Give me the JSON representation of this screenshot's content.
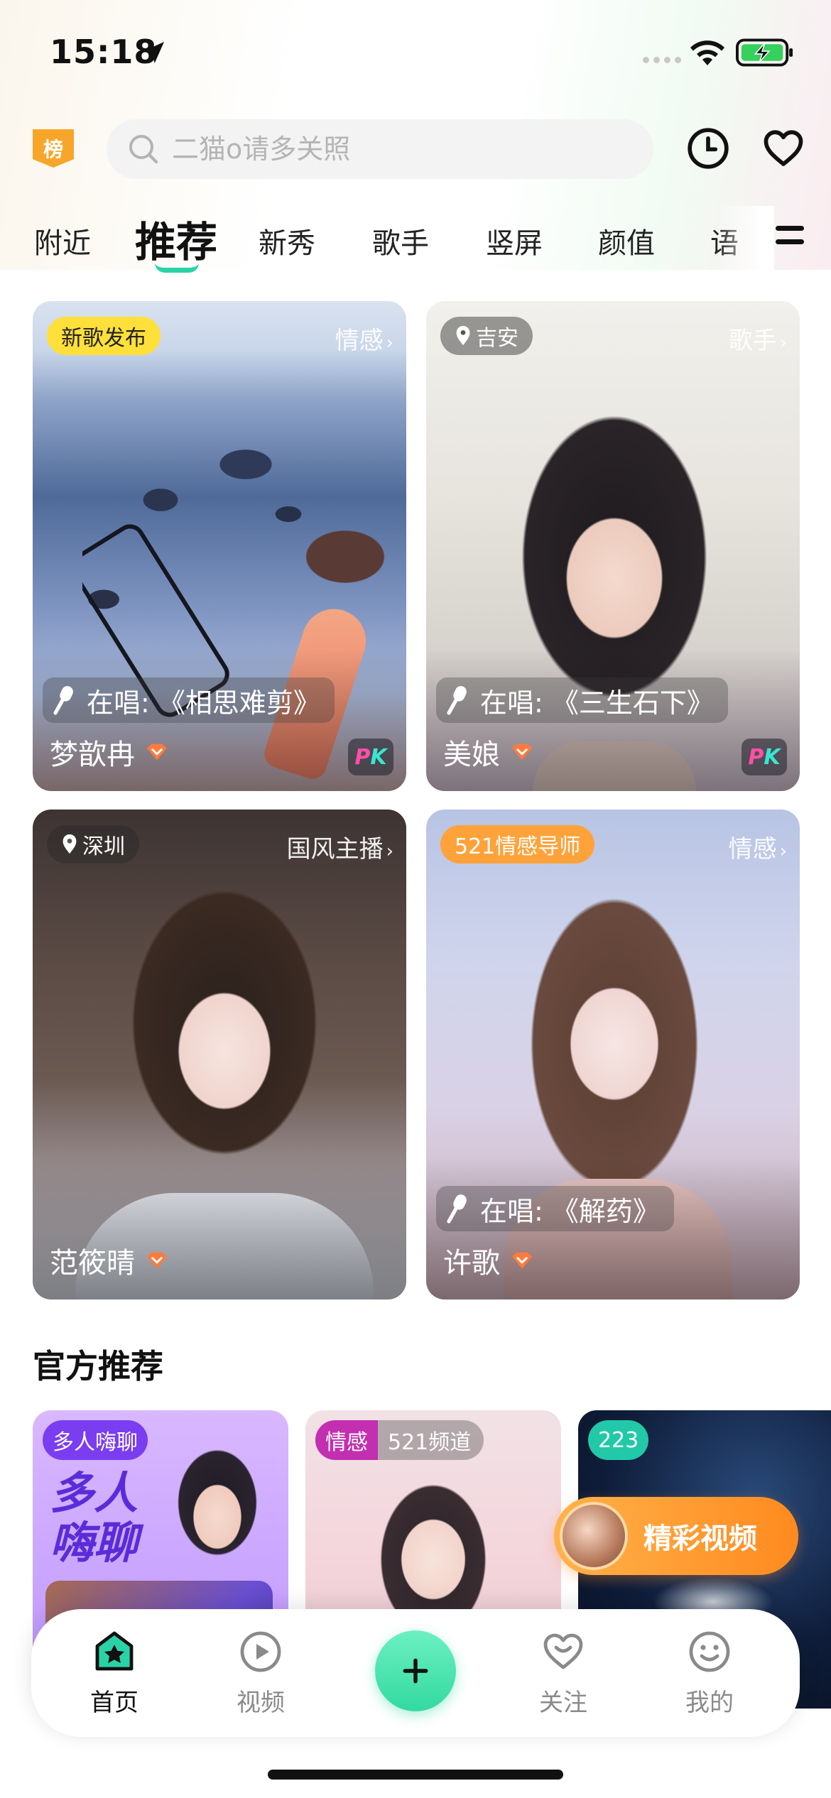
{
  "status_bar": {
    "time": "15:18"
  },
  "header": {
    "rank_badge": "榜",
    "search_placeholder": "二猫o请多关照"
  },
  "tabs": [
    "附近",
    "推荐",
    "新秀",
    "歌手",
    "竖屏",
    "颜值",
    "语"
  ],
  "active_tab": "推荐",
  "live_cards": [
    {
      "tag": "新歌发布",
      "category": "情感",
      "singing": "在唱: 《相思难剪》",
      "name": "梦歆冉",
      "pk": "PK"
    },
    {
      "location": "吉安",
      "category": "歌手",
      "singing": "在唱: 《三生石下》",
      "name": "美娘",
      "pk": "PK"
    },
    {
      "location": "深圳",
      "category": "国风主播",
      "name": "范筱晴"
    },
    {
      "tag": "521情感导师",
      "category": "情感",
      "singing": "在唱: 《解药》",
      "name": "许歌"
    }
  ],
  "section": {
    "title": "官方推荐"
  },
  "rec_cards": [
    {
      "tag": "多人嗨聊",
      "promo_text": "多人\n嗨聊"
    },
    {
      "tag": "情感",
      "channel": "521频道"
    },
    {
      "count": "223"
    }
  ],
  "float_button": {
    "label": "精彩视频"
  },
  "bottom_nav": {
    "home": "首页",
    "video": "视频",
    "follow": "关注",
    "mine": "我的"
  },
  "colors": {
    "accent_green": "#2ad3a6",
    "rank_orange": "#f7a62a",
    "tag_yellow": "#ffe03a",
    "tag_orange": "#ffa23a",
    "promo_purple": "#5a2cd9"
  }
}
